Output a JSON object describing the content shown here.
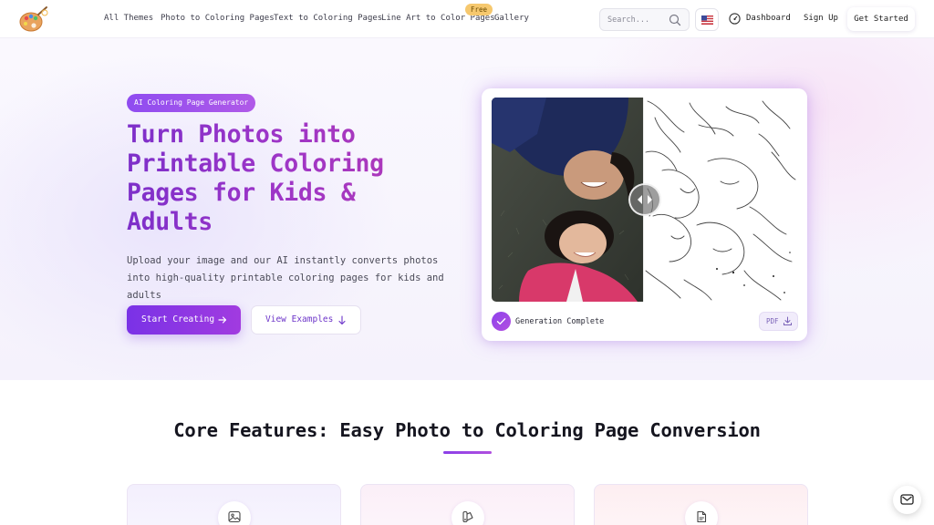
{
  "nav": {
    "links": [
      "All Themes",
      "Photo to Coloring Pages",
      "Text to Coloring Pages",
      "Line Art to Color Pages",
      "Gallery"
    ],
    "free_badge": "Free",
    "search_placeholder": "Search...",
    "dashboard": "Dashboard",
    "sign_up": "Sign Up",
    "get_started": "Get Started"
  },
  "hero": {
    "badge": "AI Coloring Page Generator",
    "title": "Turn Photos into Printable Coloring Pages for Kids & Adults",
    "subtitle": "Upload your image and our AI instantly converts photos into high-quality printable coloring pages for kids and adults",
    "primary_button": "Start Creating",
    "secondary_button": "View Examples"
  },
  "preview": {
    "status": "Generation Complete",
    "download_label": "PDF"
  },
  "features": {
    "title": "Core Features: Easy Photo to Coloring Page Conversion",
    "cards": [
      {
        "icon": "image-icon"
      },
      {
        "icon": "brush-palette-icon"
      },
      {
        "icon": "document-icon"
      }
    ]
  },
  "colors": {
    "accent": "#7a32e6",
    "accent_end": "#a13be0",
    "badge": "#8f4cf0",
    "free_badge": "#f6c86e"
  }
}
